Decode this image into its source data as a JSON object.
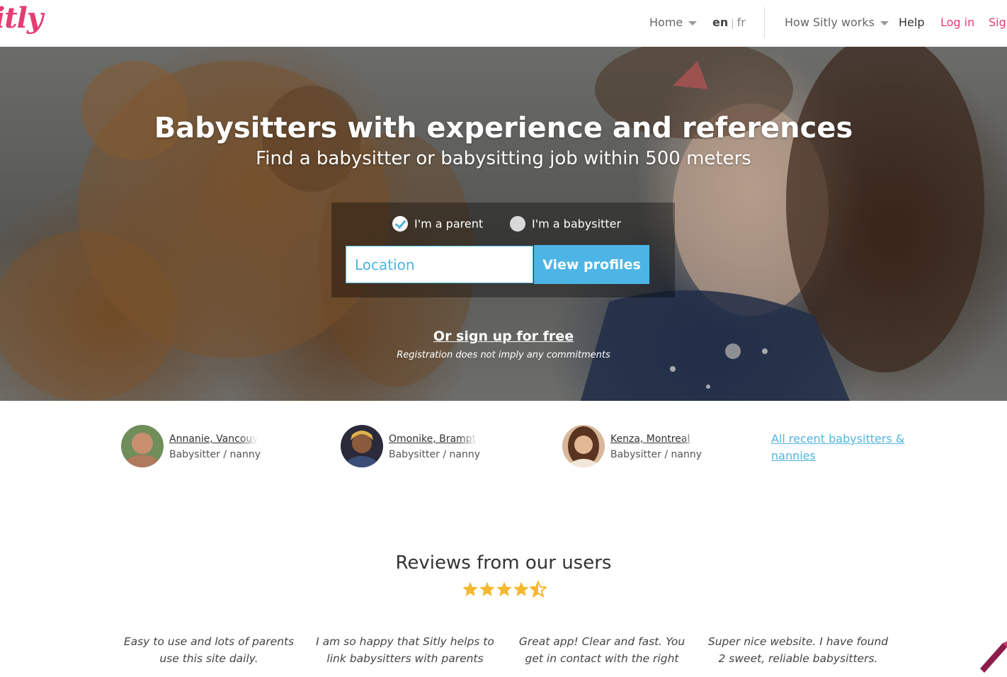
{
  "header": {
    "logo": "itly",
    "nav": {
      "home": "Home",
      "lang_en": "en",
      "lang_sep": "|",
      "lang_fr": "fr",
      "how_it_works": "How Sitly works",
      "help": "Help",
      "login": "Log in",
      "signup": "Sign"
    }
  },
  "hero": {
    "title": "Babysitters with experience and references",
    "subtitle": "Find a babysitter or babysitting job within 500 meters",
    "radio_parent": "I'm a parent",
    "radio_babysitter": "I'm a babysitter",
    "location_placeholder": "Location",
    "view_button": "View profiles",
    "signup_link": "Or sign up for free",
    "signup_note": "Registration does not imply any commitments"
  },
  "recent": {
    "sitters": [
      {
        "name": "Annanie, Vancouver",
        "role": "Babysitter / nanny"
      },
      {
        "name": "Omonike, Brampton",
        "role": "Babysitter / nanny"
      },
      {
        "name": "Kenza, Montreal",
        "role": "Babysitter / nanny"
      }
    ],
    "all_link": "All recent babysitters & nannies"
  },
  "reviews": {
    "title": "Reviews from our users",
    "rating_stars": 4.5,
    "star_color": "#f5b82e",
    "items": [
      "Easy to use and lots of parents use this site daily.",
      "I am so happy that Sitly helps to link babysitters with parents",
      "Great app! Clear and fast. You get in contact with the right",
      "Super nice website. I have found 2 sweet, reliable babysitters."
    ]
  },
  "colors": {
    "brand_pink": "#e63c71",
    "accent_blue": "#4fb4e0"
  }
}
